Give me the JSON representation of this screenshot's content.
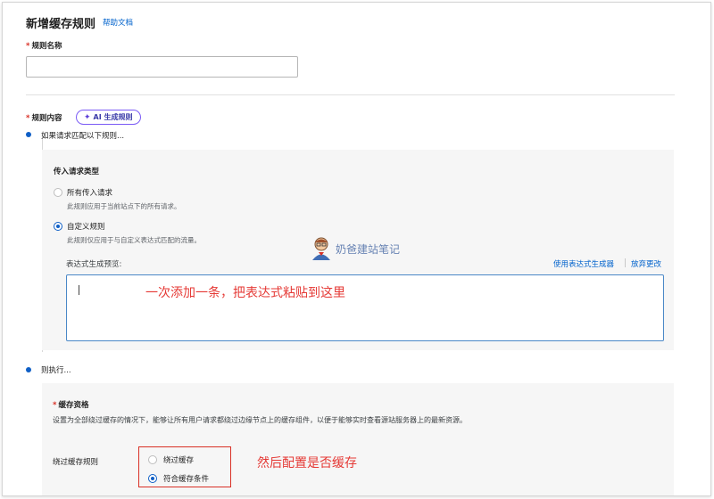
{
  "header": {
    "title": "新增缓存规则",
    "help_link": "帮助文档"
  },
  "rule_name": {
    "label": "规则名称",
    "value": "",
    "placeholder": ""
  },
  "rule_content": {
    "label": "规则内容",
    "ai_button": "AI 生成规则"
  },
  "if_step": {
    "text": "如果请求匹配以下规则..."
  },
  "incoming": {
    "title": "传入请求类型",
    "options": [
      {
        "label": "所有传入请求",
        "desc": "此规则应用于当前站点下的所有请求。",
        "selected": false
      },
      {
        "label": "自定义规则",
        "desc": "此规则仅应用于与自定义表达式匹配的流量。",
        "selected": true
      }
    ],
    "expr_label": "表达式生成预览:",
    "use_builder": "使用表达式生成器",
    "discard": "放弃更改",
    "expr_value": ""
  },
  "annotations": {
    "expr_note": "一次添加一条，把表达式粘贴到这里",
    "cache_note": "然后配置是否缓存"
  },
  "watermark": {
    "text": "奶爸建站笔记"
  },
  "then_step": {
    "text": "则执行..."
  },
  "cache": {
    "title": "缓存资格",
    "desc": "设置为全部绕过缓存的情况下，能够让所有用户请求都绕过边缘节点上的缓存组件，以便于能够实时查看源站服务器上的最新资源。",
    "rule_label": "绕过缓存规则",
    "options": [
      {
        "label": "绕过缓存",
        "selected": false
      },
      {
        "label": "符合缓存条件",
        "selected": true
      }
    ]
  },
  "colors": {
    "accent": "#0f5fc6",
    "link": "#0062cc",
    "annotation": "#e53935",
    "required": "#d93025",
    "ai_border": "#7a5af5"
  }
}
